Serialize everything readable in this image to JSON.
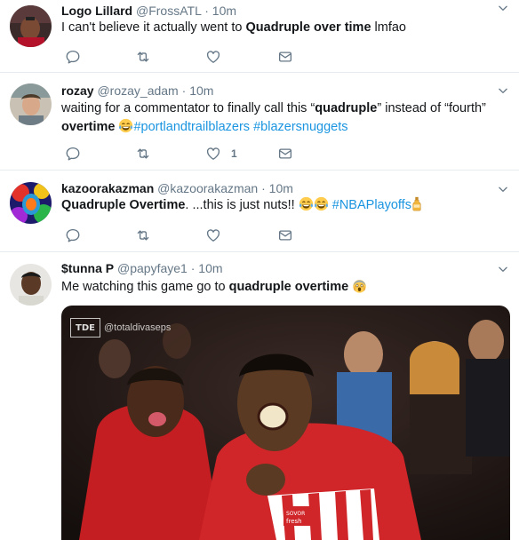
{
  "tweets": [
    {
      "name": "Logo Lillard",
      "handle": "@FrossATL",
      "sep": "·",
      "time": "10m",
      "text_a": "I can't believe it actually went to ",
      "text_b": "Quadruple over time",
      "text_c": " lmfao"
    },
    {
      "name": "rozay",
      "handle": "@rozay_adam",
      "sep": "·",
      "time": "10m",
      "text_a": "waiting for a commentator to finally call this “",
      "text_b": "quadruple",
      "text_c": "” instead of “fourth”",
      "text_d": "overtime",
      "hashtags": [
        "#portlandtrailblazers",
        "#blazersnuggets"
      ],
      "like_count": "1"
    },
    {
      "name": "kazoorakazman",
      "handle": "@kazoorakazman",
      "sep": "·",
      "time": "10m",
      "text_a": "Quadruple Overtime",
      "text_b": ". ...this is just nuts!!",
      "hashtag": "#NBAPlayoffs"
    },
    {
      "name": "$tunna P",
      "handle": "@papyfaye1",
      "sep": "·",
      "time": "10m",
      "text_a": "Me watching this game go to ",
      "text_b": "quadruple overtime",
      "media": {
        "watermark_logo": "TDE",
        "watermark_text": "@totaldivaseps"
      }
    }
  ],
  "colors": {
    "text": "#14171a",
    "secondary": "#657786",
    "link": "#1b95e0",
    "divider": "#e6ecf0"
  },
  "icons": [
    "reply-icon",
    "retweet-icon",
    "like-icon",
    "direct-message-icon",
    "chevron-down-icon",
    "tears-of-joy-emoji",
    "screaming-emoji",
    "bottle-emoji"
  ]
}
